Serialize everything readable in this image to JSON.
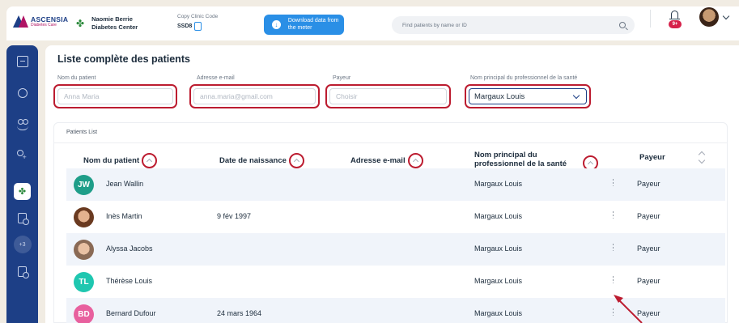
{
  "header": {
    "brand_name": "ASCENSIA",
    "brand_sub": "Diabetes Care",
    "clinic_name": "Naomie Berrie Diabetes Center",
    "copy_code_label": "Copy Clinic Code",
    "copy_code_value": "SSD8",
    "download_label": "Download data from the meter",
    "search_placeholder": "Find patients by name or ID",
    "notifications_badge": "9+"
  },
  "sidebar": {
    "more_label": "+3"
  },
  "page": {
    "title": "Liste complète des patients"
  },
  "filters": {
    "patient_name_label": "Nom du patient",
    "patient_name_placeholder": "Anna Maria",
    "email_label": "Adresse e-mail",
    "email_placeholder": "anna.maria@gmail.com",
    "payer_label": "Payeur",
    "payer_placeholder": "Choisir",
    "professional_label": "Nom principal du professionnel de la santé",
    "professional_value": "Margaux Louis"
  },
  "table": {
    "caption": "Patients List",
    "columns": {
      "name": "Nom du patient",
      "dob": "Date de naissance",
      "email": "Adresse e-mail",
      "professional": "Nom principal du professionnel de la santé",
      "payer": "Payeur"
    },
    "rows": [
      {
        "initials": "JW",
        "name": "Jean Wallin",
        "dob": "",
        "email": "",
        "professional": "Margaux Louis",
        "payer": "Payeur",
        "avatar_color": "#1f9e89"
      },
      {
        "initials": "",
        "name": "Inès Martin",
        "dob": "9 fév 1997",
        "email": "",
        "professional": "Margaux Louis",
        "payer": "Payeur",
        "avatar_color": ""
      },
      {
        "initials": "",
        "name": "Alyssa Jacobs",
        "dob": "",
        "email": "",
        "professional": "Margaux Louis",
        "payer": "Payeur",
        "avatar_color": ""
      },
      {
        "initials": "TL",
        "name": "Thérèse Louis",
        "dob": "",
        "email": "",
        "professional": "Margaux Louis",
        "payer": "Payeur",
        "avatar_color": "#1fc7b0"
      },
      {
        "initials": "BD",
        "name": "Bernard Dufour",
        "dob": "24 mars 1964",
        "email": "",
        "professional": "Margaux Louis",
        "payer": "Payeur",
        "avatar_color": "#e8609e"
      }
    ]
  },
  "colors": {
    "primary": "#1d3f86",
    "accent": "#2a8fe6",
    "highlight": "#bc1c30",
    "row_shade": "#f0f4fa"
  }
}
